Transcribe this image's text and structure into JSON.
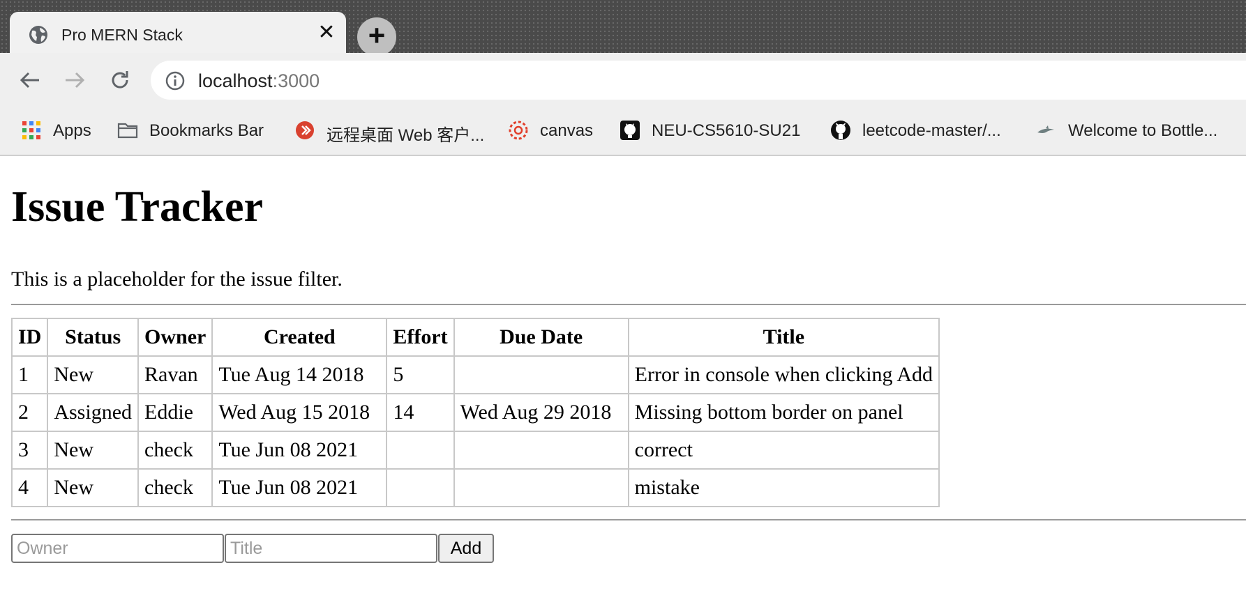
{
  "browser": {
    "tab": {
      "title": "Pro MERN Stack",
      "close": "✕"
    },
    "new_tab": "+",
    "url": {
      "host": "localhost",
      "port": ":3000"
    },
    "bookmarks": [
      {
        "label": "Apps",
        "icon": "apps-grid-icon"
      },
      {
        "label": "Bookmarks Bar",
        "icon": "folder-icon"
      },
      {
        "label": "远程桌面 Web 客户...",
        "icon": "remote-desktop-icon"
      },
      {
        "label": "canvas",
        "icon": "canvas-icon"
      },
      {
        "label": "NEU-CS5610-SU21",
        "icon": "github-square-icon"
      },
      {
        "label": "leetcode-master/...",
        "icon": "github-icon"
      },
      {
        "label": "Welcome to Bottle...",
        "icon": "bottle-icon"
      }
    ]
  },
  "page": {
    "title": "Issue Tracker",
    "filter_placeholder": "This is a placeholder for the issue filter.",
    "table": {
      "headers": [
        "ID",
        "Status",
        "Owner",
        "Created",
        "Effort",
        "Due Date",
        "Title"
      ],
      "rows": [
        [
          "1",
          "New",
          "Ravan",
          "Tue Aug 14 2018",
          "5",
          "",
          "Error in console when clicking Add"
        ],
        [
          "2",
          "Assigned",
          "Eddie",
          "Wed Aug 15 2018",
          "14",
          "Wed Aug 29 2018",
          "Missing bottom border on panel"
        ],
        [
          "3",
          "New",
          "check",
          "Tue Jun 08 2021",
          "",
          "",
          "correct"
        ],
        [
          "4",
          "New",
          "check",
          "Tue Jun 08 2021",
          "",
          "",
          "mistake"
        ]
      ]
    },
    "add_form": {
      "owner_placeholder": "Owner",
      "title_placeholder": "Title",
      "add_label": "Add"
    }
  }
}
